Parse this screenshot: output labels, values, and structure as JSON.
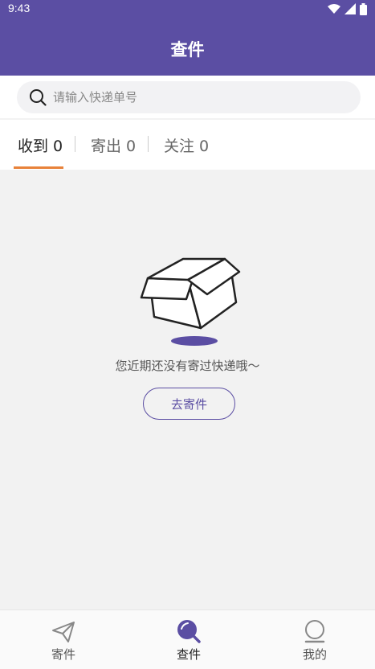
{
  "status_bar": {
    "time": "9:43"
  },
  "header": {
    "title": "查件"
  },
  "search": {
    "placeholder": "请输入快递单号",
    "icon": "search-icon"
  },
  "tabs": [
    {
      "label": "收到 0",
      "active": true
    },
    {
      "label": "寄出 0",
      "active": false
    },
    {
      "label": "关注 0",
      "active": false
    }
  ],
  "empty": {
    "message": "您近期还没有寄过快递哦～",
    "button_label": "去寄件",
    "illustration": "open-box-icon"
  },
  "bottom_nav": [
    {
      "label": "寄件",
      "icon": "paper-plane-icon",
      "active": false
    },
    {
      "label": "查件",
      "icon": "search-icon",
      "active": true
    },
    {
      "label": "我的",
      "icon": "user-icon",
      "active": false
    }
  ],
  "colors": {
    "brand": "#5b4ea3",
    "tab_indicator": "#e8823a",
    "background": "#f2f2f2"
  }
}
